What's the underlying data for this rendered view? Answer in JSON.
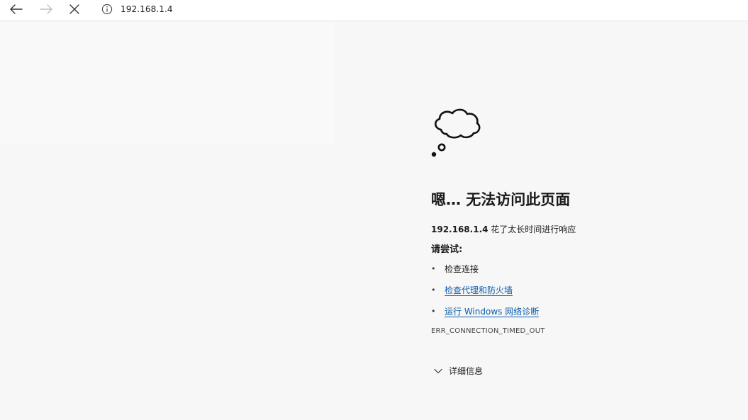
{
  "toolbar": {
    "back_icon": "arrow-left-icon",
    "forward_icon": "arrow-right-icon",
    "stop_icon": "close-icon",
    "info_icon": "info-circle-icon",
    "url": "192.168.1.4"
  },
  "error": {
    "icon": "thought-cloud-icon",
    "title": "嗯… 无法访问此页面",
    "host": "192.168.1.4",
    "subtitle_rest": " 花了太长时间进行响应",
    "try_label": "请尝试:",
    "suggestions": [
      {
        "label": "检查连接",
        "link": false
      },
      {
        "label": "检查代理和防火墙",
        "link": true
      },
      {
        "label": "运行 Windows 网络诊断",
        "link": true
      }
    ],
    "code": "ERR_CONNECTION_TIMED_OUT",
    "details_label": "详细信息",
    "link_color": "#0b5cad"
  }
}
